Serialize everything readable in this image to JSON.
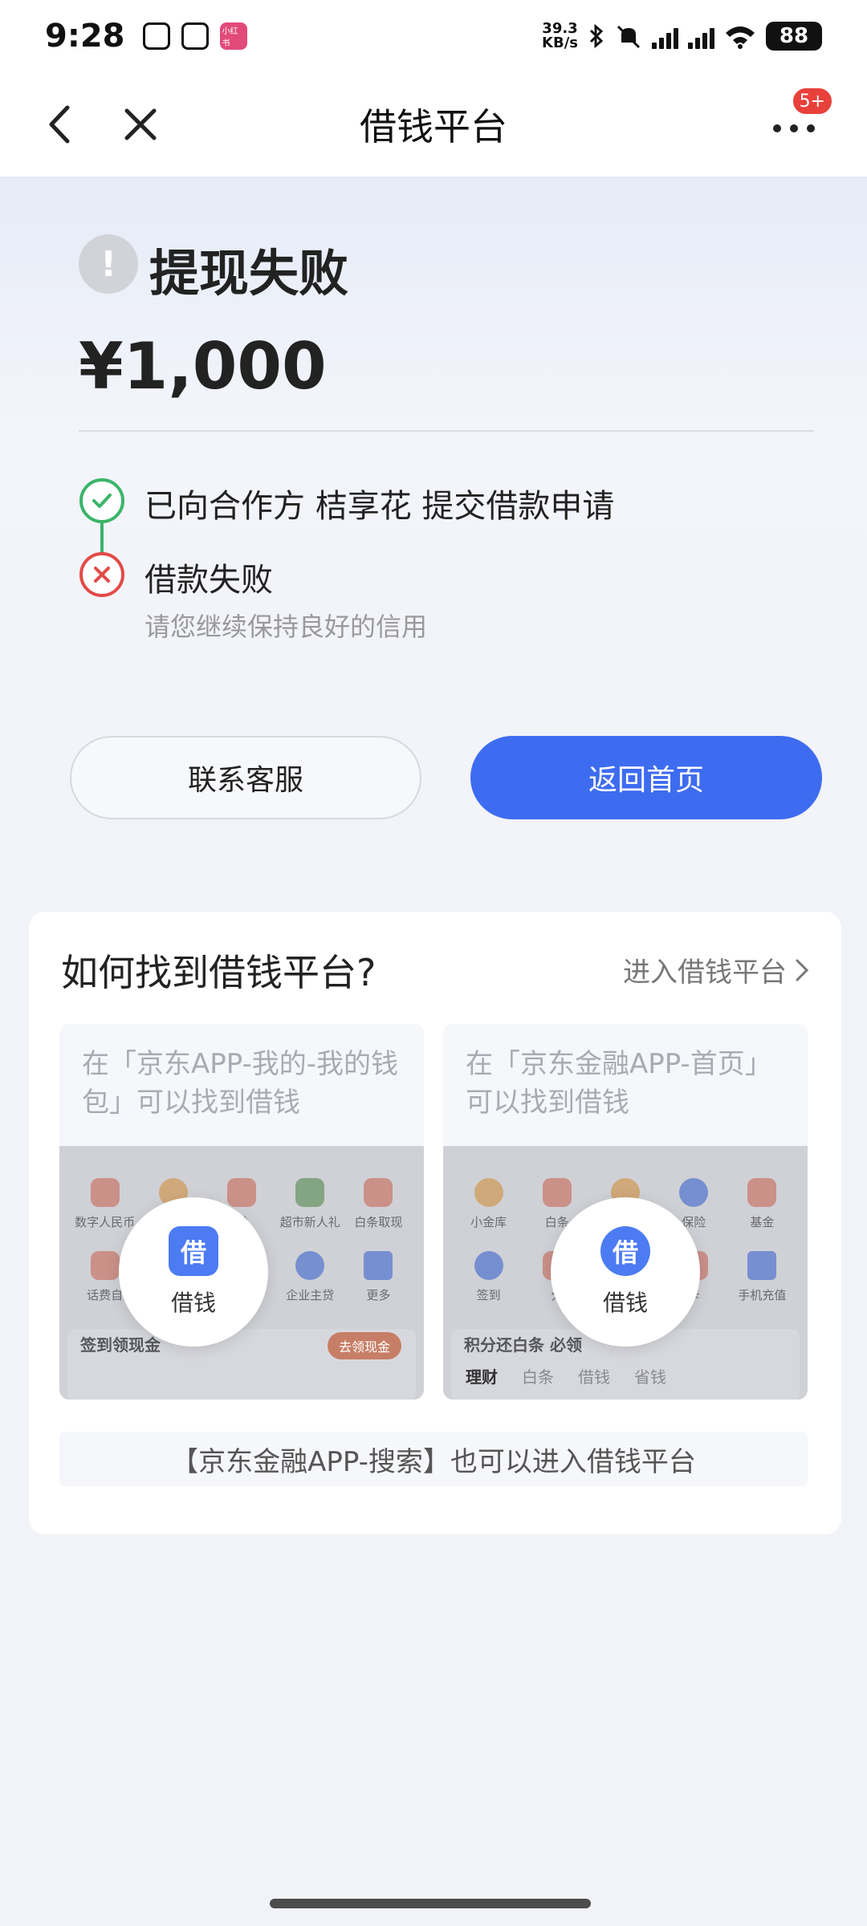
{
  "status": {
    "time": "9:28",
    "speed": "39.3\nKB/s",
    "battery": "88",
    "app_label": "小红书"
  },
  "nav": {
    "title": "借钱平台",
    "badge": "5+"
  },
  "result": {
    "title": "提现失败",
    "amount": "¥1,000",
    "step1": "已向合作方 桔享花 提交借款申请",
    "step2": "借款失败",
    "step2_sub": "请您继续保持良好的信用"
  },
  "buttons": {
    "contact": "联系客服",
    "home": "返回首页"
  },
  "card": {
    "title": "如何找到借钱平台?",
    "link": "进入借钱平台",
    "guides": [
      {
        "text": "在「京东APP-我的-我的钱包」可以找到借钱",
        "zoom_label": "借钱",
        "zoom_icon": "借",
        "items": [
          "数字人民币",
          "",
          "付",
          "超市新人礼",
          "白条取现",
          "话费自",
          "",
          "",
          "企业主贷",
          "更多"
        ],
        "band_text": "签到领现金",
        "band_pill": "去领现金"
      },
      {
        "text": "在「京东金融APP-首页」可以找到借钱",
        "zoom_label": "借钱",
        "zoom_icon": "借",
        "items": [
          "小金库",
          "白条",
          "",
          "保险",
          "基金",
          "签到",
          "分",
          "",
          "卡",
          "手机充值"
        ],
        "band_text": "积分还白条 必领",
        "tabs": [
          "理财",
          "白条",
          "借钱",
          "省钱"
        ]
      }
    ],
    "search_tip": "【京东金融APP-搜索】也可以进入借钱平台"
  },
  "colors": {
    "primary": "#3e6cf0",
    "success": "#3bb46a",
    "error": "#e24a47",
    "badge": "#e8403b"
  }
}
